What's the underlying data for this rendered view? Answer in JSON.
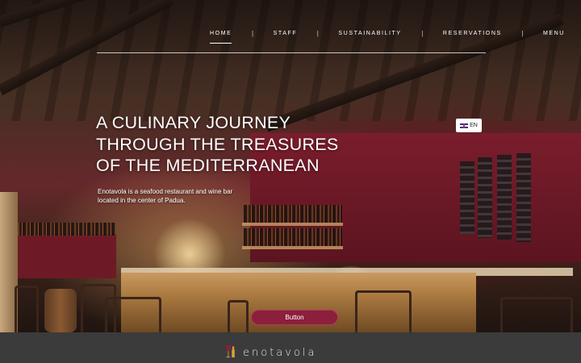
{
  "nav": {
    "items": [
      {
        "label": "HOME",
        "active": true
      },
      {
        "label": "STAFF",
        "active": false
      },
      {
        "label": "SUSTAINABILITY",
        "active": false
      },
      {
        "label": "RESERVATIONS",
        "active": false
      },
      {
        "label": "MENU",
        "active": false
      }
    ],
    "separator": "|"
  },
  "hero": {
    "headline_line1": "A CULINARY JOURNEY",
    "headline_line2": "THROUGH THE TREASURES",
    "headline_line3": "OF THE MEDITERRANEAN",
    "tagline": "Enotavola is a seafood restaurant and wine bar located in the center of Padua.",
    "button_label": "Button"
  },
  "language": {
    "code": "EN",
    "flag_icon": "uk-flag-icon"
  },
  "footer": {
    "logo_text": "enotavola"
  },
  "colors": {
    "accent": "#8b1f3c",
    "footer_bg": "#3b3b3b",
    "wine_wall": "#7a1d2c"
  }
}
